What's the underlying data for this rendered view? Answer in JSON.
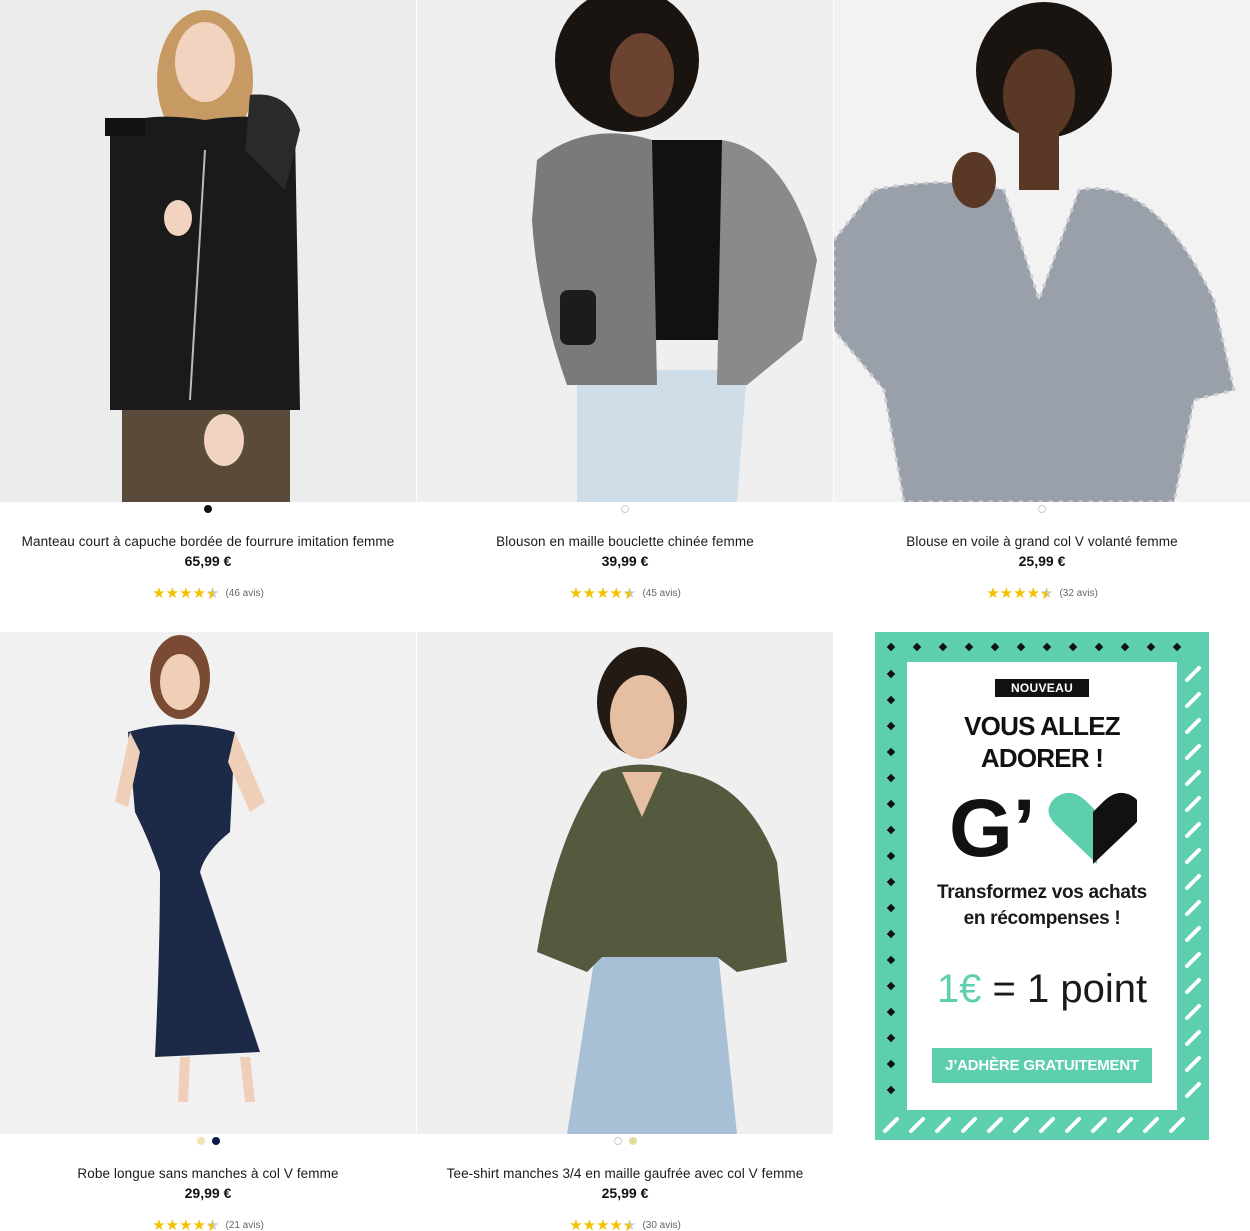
{
  "products": [
    {
      "title": "Manteau court à capuche bordée de fourrure imitation femme",
      "price": "65,99 €",
      "rating": 4.5,
      "reviews": "(46 avis)",
      "swatches": [
        "#111111"
      ],
      "active_swatch": 0,
      "image": "woman-black-fur-hood-coat"
    },
    {
      "title": "Blouson en maille bouclette chinée femme",
      "price": "39,99 €",
      "rating": 4.5,
      "reviews": "(45 avis)",
      "swatches": [
        "#ffffff"
      ],
      "active_swatch": 0,
      "image": "woman-grey-boucle-jacket"
    },
    {
      "title": "Blouse en voile à grand col V volanté femme",
      "price": "25,99 €",
      "rating": 4.5,
      "reviews": "(32 avis)",
      "swatches": [
        "#ffffff"
      ],
      "active_swatch": 0,
      "image": "woman-grey-floral-blouse"
    },
    {
      "title": "Robe longue sans manches à col V femme",
      "price": "29,99 €",
      "rating": 4.5,
      "reviews": "(21 avis)",
      "swatches": [
        "#f2e3b3",
        "#0d1a4a"
      ],
      "active_swatch": 1,
      "image": "woman-navy-long-dress"
    },
    {
      "title": "Tee-shirt manches 3/4 en maille gaufrée avec col V femme",
      "price": "25,99 €",
      "rating": 4.5,
      "reviews": "(30 avis)",
      "swatches": [
        "#ffffff",
        "#e0dd9a"
      ],
      "active_swatch": 0,
      "image": "woman-khaki-waffle-top"
    }
  ],
  "promo": {
    "badge": "NOUVEAU",
    "headline_line1": "VOUS ALLEZ",
    "headline_line2": "ADORER !",
    "logo_text": "G’",
    "logo_icon": "heart-icon",
    "sub_line1": "Transformez vos achats",
    "sub_line2": "en récompenses !",
    "points_currency": "1€",
    "points_rest": " = 1 point",
    "cta_label": "J’ADHÈRE GRATUITEMENT",
    "accent_color": "#5dcfae"
  },
  "colors": {
    "star": "#f2c200",
    "photo_bg": "#eeeeef"
  }
}
